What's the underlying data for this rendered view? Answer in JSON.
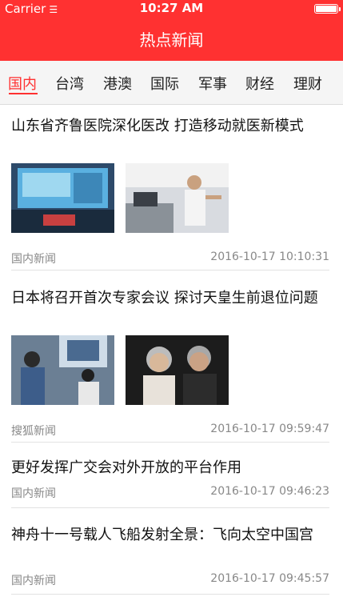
{
  "status_bar": {
    "carrier": "Carrier",
    "wifi_icon": "wifi-icon",
    "time": "10:27 AM",
    "battery_icon": "battery-icon"
  },
  "nav": {
    "title": "热点新闻"
  },
  "tabs": [
    {
      "label": "国内",
      "active": true
    },
    {
      "label": "台湾",
      "active": false
    },
    {
      "label": "港澳",
      "active": false
    },
    {
      "label": "国际",
      "active": false
    },
    {
      "label": "军事",
      "active": false
    },
    {
      "label": "财经",
      "active": false
    },
    {
      "label": "理财",
      "active": false
    }
  ],
  "articles": [
    {
      "title": "山东省齐鲁医院深化医改 打造移动就医新模式",
      "source": "国内新闻",
      "time": "2016-10-17 10:10:31",
      "images": [
        "atm-kiosk-photo",
        "hospital-office-man-photo"
      ]
    },
    {
      "title": "日本将召开首次专家会议 探讨天皇生前退位问题",
      "source": "搜狐新闻",
      "time": "2016-10-17 09:59:47",
      "images": [
        "people-watching-tv-photo",
        "emperor-empress-photo"
      ]
    },
    {
      "title": "更好发挥广交会对外开放的平台作用",
      "source": "国内新闻",
      "time": "2016-10-17 09:46:23",
      "images": []
    },
    {
      "title": "神舟十一号载人飞船发射全景：飞向太空中国宫",
      "source": "国内新闻",
      "time": "2016-10-17 09:45:57",
      "images": []
    }
  ],
  "colors": {
    "accent": "#ff3131",
    "meta": "#888888"
  }
}
